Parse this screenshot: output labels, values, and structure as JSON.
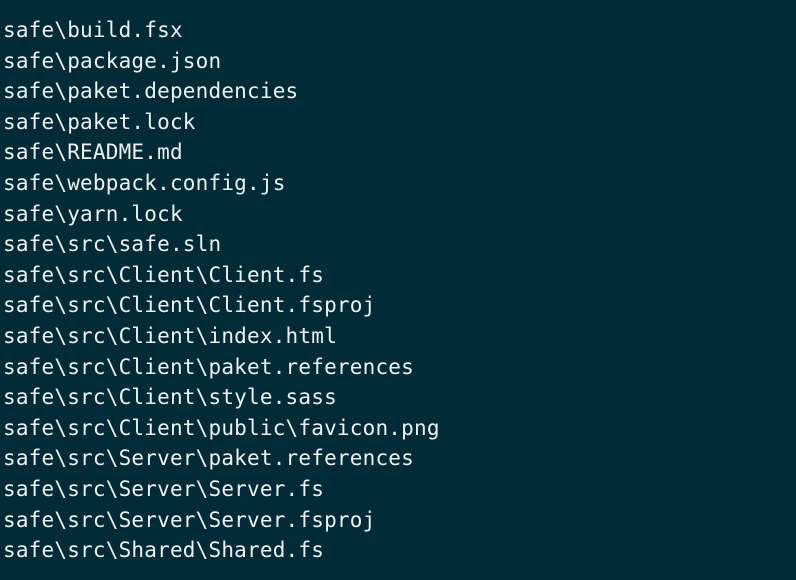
{
  "terminal": {
    "lines": [
      "safe\\build.fsx",
      "safe\\package.json",
      "safe\\paket.dependencies",
      "safe\\paket.lock",
      "safe\\README.md",
      "safe\\webpack.config.js",
      "safe\\yarn.lock",
      "safe\\src\\safe.sln",
      "safe\\src\\Client\\Client.fs",
      "safe\\src\\Client\\Client.fsproj",
      "safe\\src\\Client\\index.html",
      "safe\\src\\Client\\paket.references",
      "safe\\src\\Client\\style.sass",
      "safe\\src\\Client\\public\\favicon.png",
      "safe\\src\\Server\\paket.references",
      "safe\\src\\Server\\Server.fs",
      "safe\\src\\Server\\Server.fsproj",
      "safe\\src\\Shared\\Shared.fs"
    ]
  },
  "colors": {
    "background": "#012b36",
    "text": "#eef1f1"
  }
}
